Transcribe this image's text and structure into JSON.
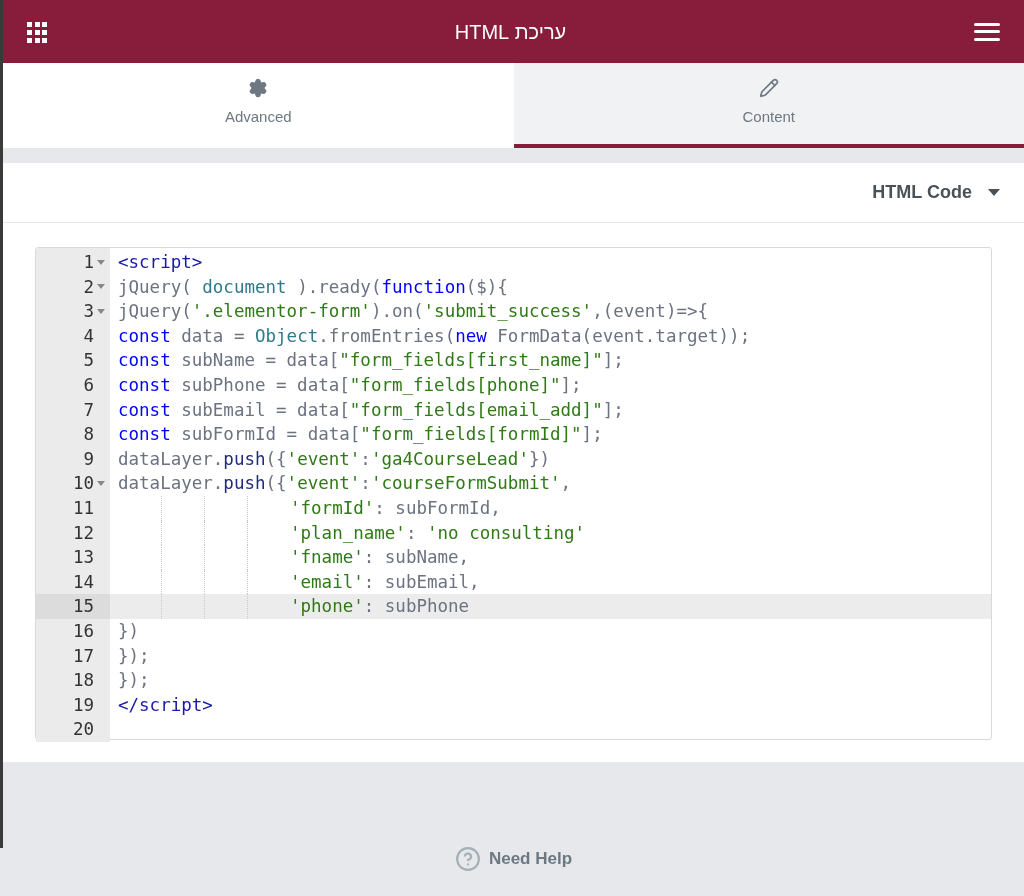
{
  "header": {
    "title": "עריכת HTML"
  },
  "tabs": [
    {
      "label": "Advanced",
      "selected": false
    },
    {
      "label": "Content",
      "selected": true
    }
  ],
  "section": {
    "title": "HTML Code",
    "expanded": true
  },
  "code_lines": [
    {
      "number": "1",
      "foldable": true,
      "active": false,
      "kind": "plain",
      "tokens": [
        {
          "t": "<script>",
          "kind": "tag"
        }
      ]
    },
    {
      "number": "2",
      "foldable": true,
      "active": false,
      "kind": "plain",
      "tokens": [
        {
          "t": "jQuery( ",
          "kind": "plain"
        },
        {
          "t": "document",
          "kind": "variable"
        },
        {
          "t": " ).ready(",
          "kind": "plain"
        },
        {
          "t": "function",
          "kind": "keyword"
        },
        {
          "t": "($){",
          "kind": "plain"
        }
      ]
    },
    {
      "number": "3",
      "foldable": true,
      "active": false,
      "kind": "plain",
      "tokens": [
        {
          "t": "jQuery(",
          "kind": "plain"
        },
        {
          "t": "'.elementor-form'",
          "kind": "string"
        },
        {
          "t": ").on(",
          "kind": "plain"
        },
        {
          "t": "'submit_success'",
          "kind": "string"
        },
        {
          "t": ",(event)=>{",
          "kind": "plain"
        }
      ]
    },
    {
      "number": "4",
      "foldable": false,
      "active": false,
      "kind": "plain",
      "tokens": [
        {
          "t": "const",
          "kind": "keyword"
        },
        {
          "t": " data = ",
          "kind": "plain"
        },
        {
          "t": "Object",
          "kind": "variable"
        },
        {
          "t": ".fromEntries(",
          "kind": "plain"
        },
        {
          "t": "new",
          "kind": "keyword"
        },
        {
          "t": " FormData(event.target));",
          "kind": "plain"
        }
      ]
    },
    {
      "number": "5",
      "foldable": false,
      "active": false,
      "kind": "plain",
      "tokens": [
        {
          "t": "const",
          "kind": "keyword"
        },
        {
          "t": " subName = data[",
          "kind": "plain"
        },
        {
          "t": "\"form_fields[first_name]\"",
          "kind": "string"
        },
        {
          "t": "];",
          "kind": "plain"
        }
      ]
    },
    {
      "number": "6",
      "foldable": false,
      "active": false,
      "kind": "plain",
      "tokens": [
        {
          "t": "const",
          "kind": "keyword"
        },
        {
          "t": " subPhone = data[",
          "kind": "plain"
        },
        {
          "t": "\"form_fields[phone]\"",
          "kind": "string"
        },
        {
          "t": "];",
          "kind": "plain"
        }
      ]
    },
    {
      "number": "7",
      "foldable": false,
      "active": false,
      "kind": "plain",
      "tokens": [
        {
          "t": "const",
          "kind": "keyword"
        },
        {
          "t": " subEmail = data[",
          "kind": "plain"
        },
        {
          "t": "\"form_fields[email_add]\"",
          "kind": "string"
        },
        {
          "t": "];",
          "kind": "plain"
        }
      ]
    },
    {
      "number": "8",
      "foldable": false,
      "active": false,
      "kind": "plain",
      "tokens": [
        {
          "t": "const",
          "kind": "keyword"
        },
        {
          "t": " subFormId = data[",
          "kind": "plain"
        },
        {
          "t": "\"form_fields[formId]\"",
          "kind": "string"
        },
        {
          "t": "];",
          "kind": "plain"
        }
      ]
    },
    {
      "number": "9",
      "foldable": false,
      "active": false,
      "kind": "plain",
      "tokens": [
        {
          "t": "dataLayer.",
          "kind": "plain"
        },
        {
          "t": "push",
          "kind": "method"
        },
        {
          "t": "({",
          "kind": "plain"
        },
        {
          "t": "'event'",
          "kind": "string"
        },
        {
          "t": ":",
          "kind": "plain"
        },
        {
          "t": "'ga4CourseLead'",
          "kind": "string"
        },
        {
          "t": "})",
          "kind": "plain"
        }
      ]
    },
    {
      "number": "10",
      "foldable": true,
      "active": false,
      "kind": "plain",
      "tokens": [
        {
          "t": "dataLayer.",
          "kind": "plain"
        },
        {
          "t": "push",
          "kind": "method"
        },
        {
          "t": "({",
          "kind": "plain"
        },
        {
          "t": "'event'",
          "kind": "string"
        },
        {
          "t": ":",
          "kind": "plain"
        },
        {
          "t": "'courseFormSubmit'",
          "kind": "string"
        },
        {
          "t": ",",
          "kind": "plain"
        }
      ]
    },
    {
      "number": "11",
      "foldable": false,
      "active": false,
      "kind": "indented",
      "tokens": [
        {
          "t": "'formId'",
          "kind": "string"
        },
        {
          "t": ": subFormId,",
          "kind": "plain"
        }
      ]
    },
    {
      "number": "12",
      "foldable": false,
      "active": false,
      "kind": "indented",
      "tokens": [
        {
          "t": "'plan_name'",
          "kind": "string"
        },
        {
          "t": ": ",
          "kind": "plain"
        },
        {
          "t": "'no consulting'",
          "kind": "string"
        }
      ]
    },
    {
      "number": "13",
      "foldable": false,
      "active": false,
      "kind": "indented",
      "tokens": [
        {
          "t": "'fname'",
          "kind": "string"
        },
        {
          "t": ": subName,",
          "kind": "plain"
        }
      ]
    },
    {
      "number": "14",
      "foldable": false,
      "active": false,
      "kind": "indented",
      "tokens": [
        {
          "t": "'email'",
          "kind": "string"
        },
        {
          "t": ": subEmail,",
          "kind": "plain"
        }
      ]
    },
    {
      "number": "15",
      "foldable": false,
      "active": true,
      "kind": "indented",
      "tokens": [
        {
          "t": "'phone'",
          "kind": "string"
        },
        {
          "t": ": subPhone",
          "kind": "plain"
        }
      ]
    },
    {
      "number": "16",
      "foldable": false,
      "active": false,
      "kind": "plain",
      "tokens": [
        {
          "t": "})",
          "kind": "plain"
        }
      ]
    },
    {
      "number": "17",
      "foldable": false,
      "active": false,
      "kind": "plain",
      "tokens": [
        {
          "t": "});",
          "kind": "plain"
        }
      ]
    },
    {
      "number": "18",
      "foldable": false,
      "active": false,
      "kind": "plain",
      "tokens": [
        {
          "t": "});",
          "kind": "plain"
        }
      ]
    },
    {
      "number": "19",
      "foldable": false,
      "active": false,
      "kind": "plain",
      "tokens": [
        {
          "t": "</script>",
          "kind": "tag"
        }
      ]
    },
    {
      "number": "20",
      "foldable": false,
      "active": false,
      "kind": "plain"
    }
  ],
  "help": {
    "label": "Need Help"
  }
}
